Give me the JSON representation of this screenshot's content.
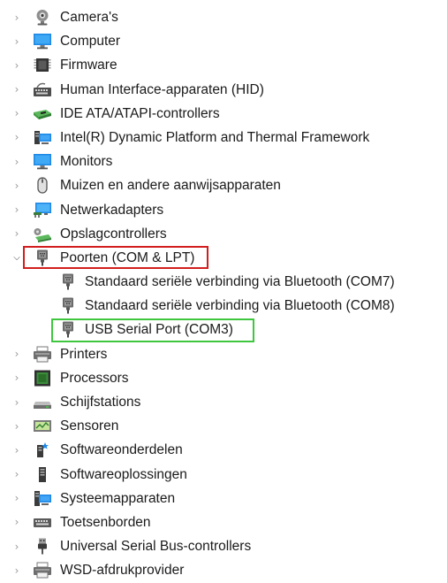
{
  "device_tree": {
    "items": [
      {
        "label": "Camera's",
        "icon": "webcam-icon"
      },
      {
        "label": "Computer",
        "icon": "monitor-icon"
      },
      {
        "label": "Firmware",
        "icon": "firmware-chip-icon"
      },
      {
        "label": "Human Interface-apparaten (HID)",
        "icon": "hid-keyboard-icon"
      },
      {
        "label": "IDE ATA/ATAPI-controllers",
        "icon": "ide-controller-icon"
      },
      {
        "label": "Intel(R) Dynamic Platform and Thermal Framework",
        "icon": "intel-framework-icon"
      },
      {
        "label": "Monitors",
        "icon": "monitor-icon"
      },
      {
        "label": "Muizen en andere aanwijsapparaten",
        "icon": "mouse-icon"
      },
      {
        "label": "Netwerkadapters",
        "icon": "network-adapter-icon"
      },
      {
        "label": "Opslagcontrollers",
        "icon": "storage-controller-icon"
      },
      {
        "label": "Poorten (COM & LPT)",
        "icon": "port-connector-icon",
        "expanded": true,
        "children": [
          {
            "label": "Standaard seriële verbinding via Bluetooth (COM7)",
            "icon": "port-connector-icon"
          },
          {
            "label": "Standaard seriële verbinding via Bluetooth (COM8)",
            "icon": "port-connector-icon"
          },
          {
            "label": "USB Serial Port (COM3)",
            "icon": "port-connector-icon"
          }
        ]
      },
      {
        "label": "Printers",
        "icon": "printer-icon"
      },
      {
        "label": "Processors",
        "icon": "processor-icon"
      },
      {
        "label": "Schijfstations",
        "icon": "disk-drive-icon"
      },
      {
        "label": "Sensoren",
        "icon": "sensor-icon"
      },
      {
        "label": "Softwareonderdelen",
        "icon": "software-component-icon"
      },
      {
        "label": "Softwareoplossingen",
        "icon": "software-device-icon"
      },
      {
        "label": "Systeemapparaten",
        "icon": "system-device-icon"
      },
      {
        "label": "Toetsenborden",
        "icon": "keyboard-icon"
      },
      {
        "label": "Universal Serial Bus-controllers",
        "icon": "usb-plug-icon"
      },
      {
        "label": "WSD-afdrukprovider",
        "icon": "printer-icon"
      }
    ]
  },
  "highlights": {
    "red_color": "#d21e1e",
    "green_color": "#3fc63f",
    "red_item": "Poorten (COM & LPT)",
    "green_item": "USB Serial Port (COM3)"
  }
}
